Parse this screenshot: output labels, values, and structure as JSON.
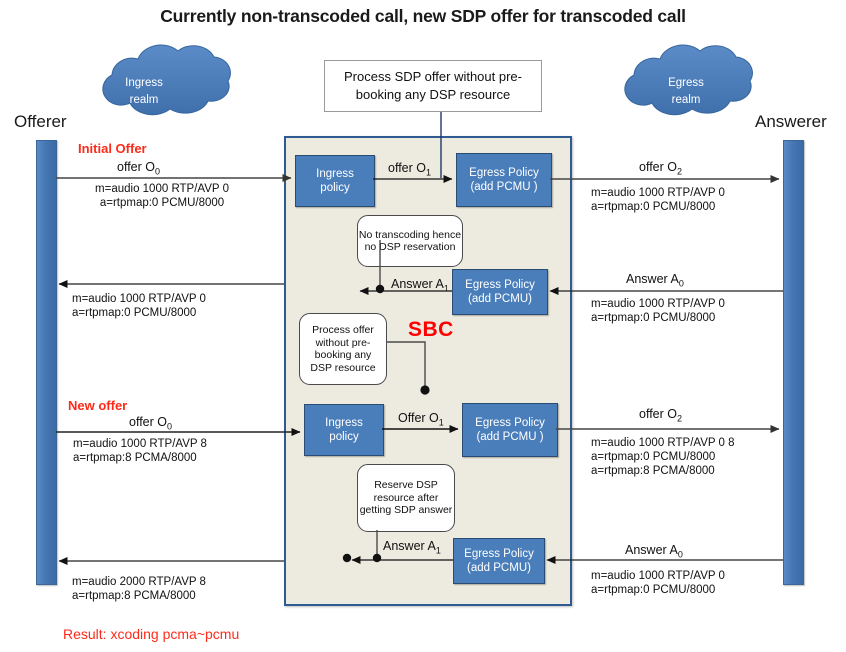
{
  "title": "Currently non-transcoded call, new SDP offer for transcoded call",
  "actors": {
    "offerer": "Offerer",
    "answerer": "Answerer"
  },
  "clouds": {
    "ingress": {
      "line1": "Ingress",
      "line2": "realm"
    },
    "egress": {
      "line1": "Egress",
      "line2": "realm"
    }
  },
  "sbc": {
    "label": "SBC",
    "top_note": "Process SDP offer without pre-booking any DSP resource",
    "notes": {
      "no_transcoding": "No transcoding hence no DSP reservation",
      "process_offer": "Process offer without pre-booking any DSP resource",
      "reserve_dsp": "Reserve DSP resource after getting SDP answer"
    },
    "policies": {
      "ingress_1": {
        "line1": "Ingress",
        "line2": "policy"
      },
      "egress_1": {
        "line1": "Egress Policy",
        "line2": "(add PCMU )"
      },
      "egress_answer_1": {
        "line1": "Egress Policy",
        "line2": "(add PCMU)"
      },
      "ingress_2": {
        "line1": "Ingress",
        "line2": "policy"
      },
      "egress_2": {
        "line1": "Egress Policy",
        "line2": "(add PCMU )"
      },
      "egress_answer_2": {
        "line1": "Egress Policy",
        "line2": "(add PCMU)"
      }
    }
  },
  "flow1": {
    "phase_label": "Initial Offer",
    "offer_o0": {
      "name": "offer O",
      "sub": "0"
    },
    "offer_o0_sdp_1": "m=audio 1000 RTP/AVP 0",
    "offer_o0_sdp_2": "a=rtpmap:0 PCMU/8000",
    "offer_o1": {
      "name": "offer O",
      "sub": "1"
    },
    "offer_o2": {
      "name": "offer O",
      "sub": "2"
    },
    "offer_o2_sdp_1": "m=audio 1000 RTP/AVP 0",
    "offer_o2_sdp_2": "a=rtpmap:0 PCMU/8000",
    "answer_a0": {
      "name": "Answer A",
      "sub": "0"
    },
    "answer_a0_sdp_1": "m=audio 1000 RTP/AVP 0",
    "answer_a0_sdp_2": "a=rtpmap:0 PCMU/8000",
    "answer_a1": {
      "name": "Answer A",
      "sub": "1"
    },
    "answer_left_sdp_1": "m=audio 1000 RTP/AVP 0",
    "answer_left_sdp_2": "a=rtpmap:0 PCMU/8000"
  },
  "flow2": {
    "phase_label": "New offer",
    "offer_o0": {
      "name": "offer O",
      "sub": "0"
    },
    "offer_o0_sdp_1": "m=audio 1000 RTP/AVP 8",
    "offer_o0_sdp_2": "a=rtpmap:8 PCMA/8000",
    "offer_o1": {
      "name": "Offer O",
      "sub": "1"
    },
    "offer_o2": {
      "name": "offer O",
      "sub": "2"
    },
    "offer_o2_sdp_1": "m=audio 1000 RTP/AVP 0 8",
    "offer_o2_sdp_2": "a=rtpmap:0 PCMU/8000",
    "offer_o2_sdp_3": "a=rtpmap:8 PCMA/8000",
    "answer_a0": {
      "name": "Answer A",
      "sub": "0"
    },
    "answer_a0_sdp_1": "m=audio 1000 RTP/AVP 0",
    "answer_a0_sdp_2": "a=rtpmap:0 PCMU/8000",
    "answer_a1": {
      "name": "Answer A",
      "sub": "1"
    },
    "answer_left_sdp_1": "m=audio 2000 RTP/AVP 8",
    "answer_left_sdp_2": "a=rtpmap:8 PCMA/8000"
  },
  "result": "Result: xcoding pcma~pcmu",
  "colors": {
    "policy_blue": "#4A7EBB",
    "lifeline_blue": "#4477B4",
    "sbc_fill": "#EDEADF",
    "sbc_border": "#2E5B91",
    "accent_red": "#FF2B1A",
    "sbc_red": "#FF0000",
    "cloud_blue": "#4A7EBB"
  }
}
